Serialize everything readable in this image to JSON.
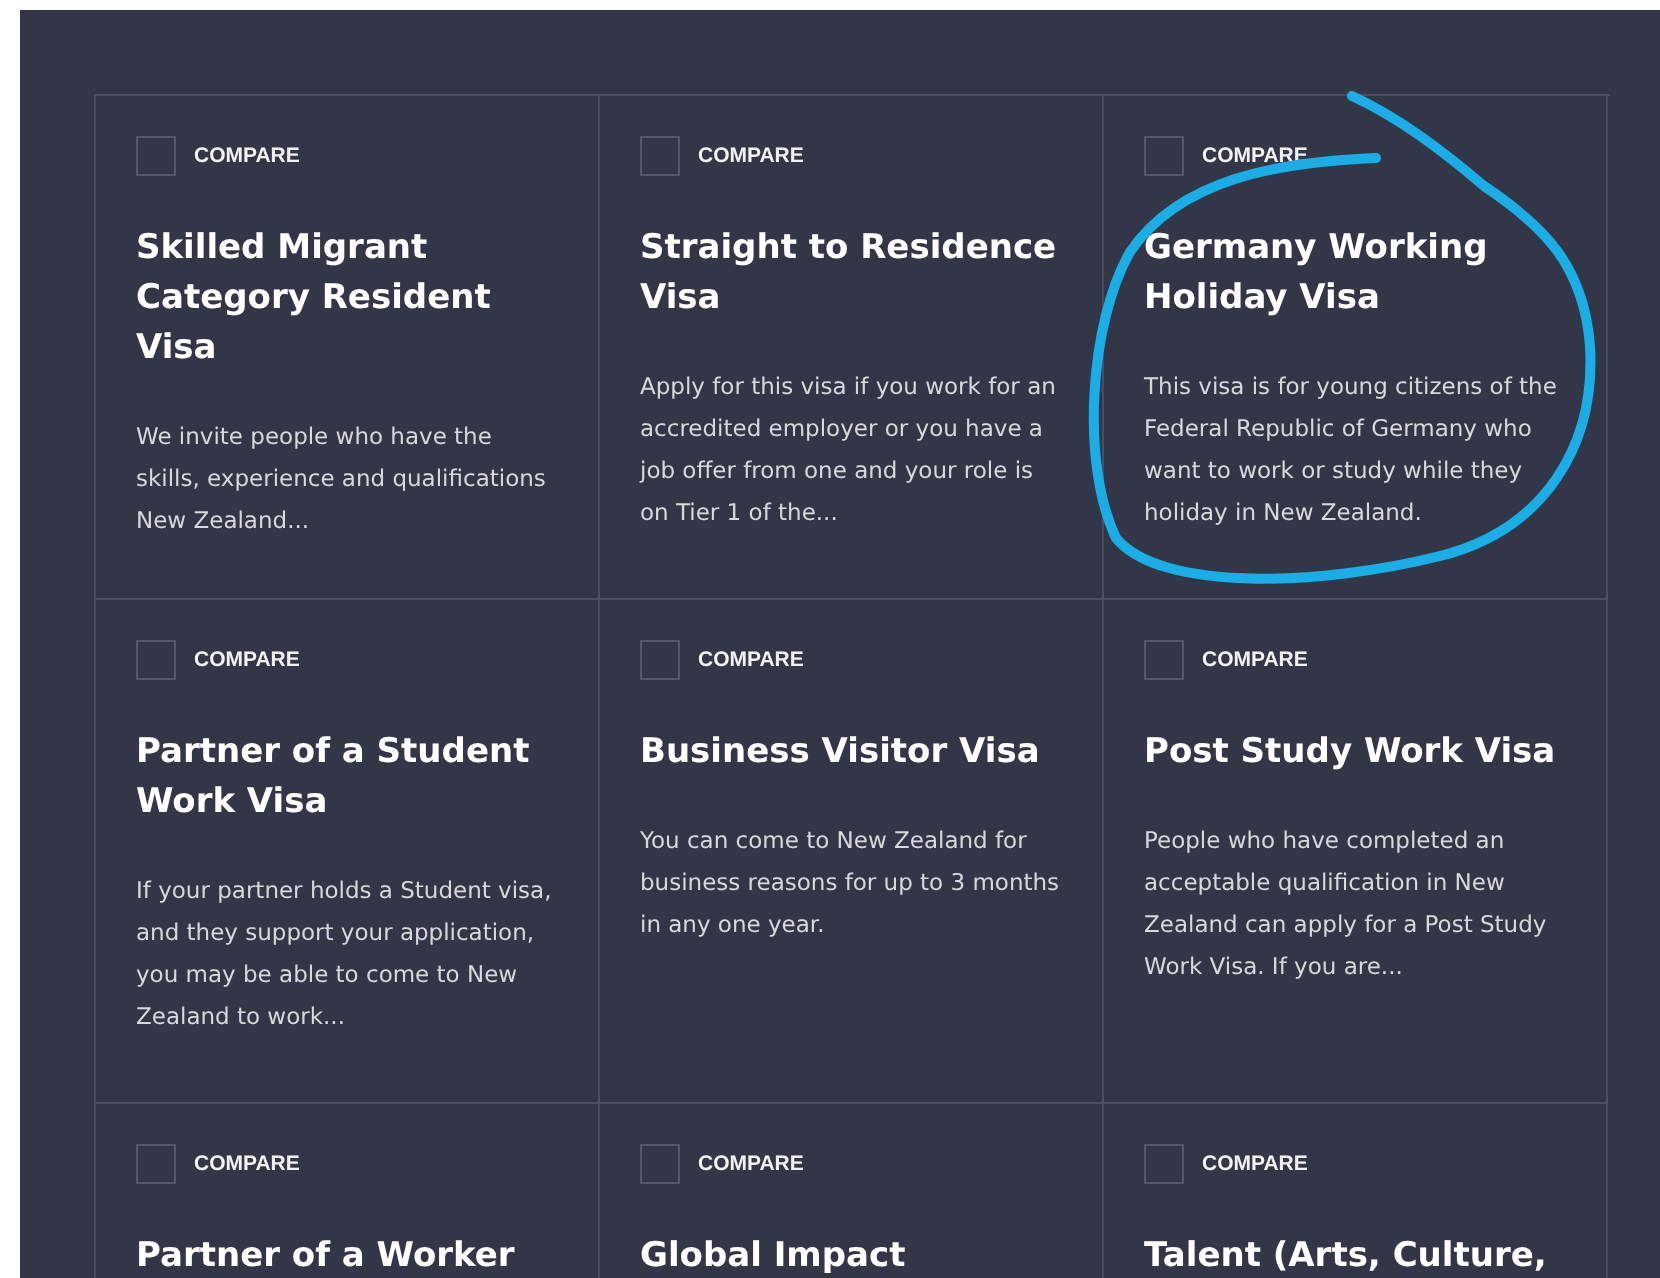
{
  "cards": [
    {
      "compare_label": "COMPARE",
      "compare_checked": false,
      "title": "Skilled Migrant Category Resident Visa",
      "description": "We invite people who have the skills, experience and qualifications New Zealand...",
      "circled": false
    },
    {
      "compare_label": "COMPARE",
      "compare_checked": false,
      "title": "Straight to Residence Visa",
      "description": "Apply for this visa if you work for an accredited employer or you have a job offer from one and your role is on Tier 1 of the...",
      "circled": false
    },
    {
      "compare_label": "COMPARE",
      "compare_checked": false,
      "title": "Germany Working Holiday Visa",
      "description": "This visa is for young citizens of the Federal Republic of Germany who want to work or study while they holiday in New Zealand.",
      "circled": true
    },
    {
      "compare_label": "COMPARE",
      "compare_checked": false,
      "title": "Partner of a Student Work Visa",
      "description": "If your partner holds a Student visa, and they support your application, you may be able to come to New Zealand to work...",
      "circled": false
    },
    {
      "compare_label": "COMPARE",
      "compare_checked": false,
      "title": "Business Visitor Visa",
      "description": "You can come to New Zealand for business reasons for up to 3 months in any one year.",
      "circled": false
    },
    {
      "compare_label": "COMPARE",
      "compare_checked": false,
      "title": "Post Study Work Visa",
      "description": "People who have completed an acceptable qualification in New Zealand can apply for a Post Study Work Visa. If you are...",
      "circled": false
    },
    {
      "compare_label": "COMPARE",
      "compare_checked": false,
      "title": "Partner of a Worker",
      "circled": false
    },
    {
      "compare_label": "COMPARE",
      "compare_checked": false,
      "title": "Global Impact",
      "circled": false
    },
    {
      "compare_label": "COMPARE",
      "compare_checked": false,
      "title": "Talent (Arts, Culture,",
      "circled": false
    }
  ]
}
